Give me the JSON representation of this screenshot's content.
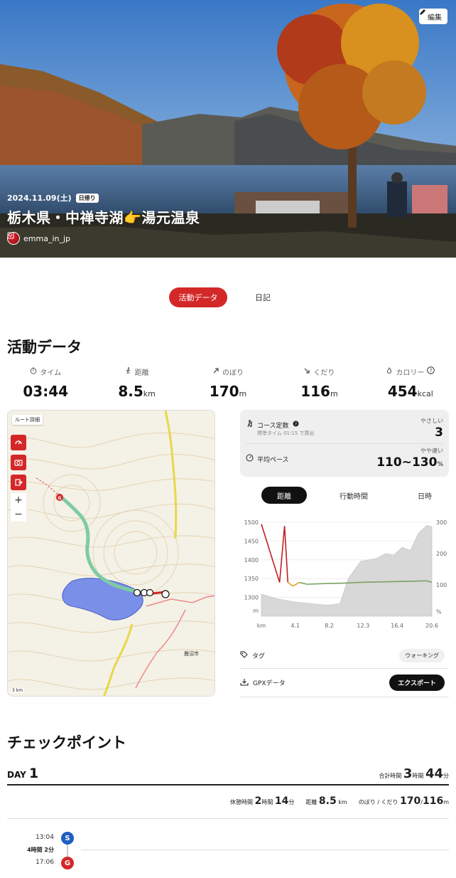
{
  "hero": {
    "edit_label": "編集",
    "date": "2024.11.09(土)",
    "badge": "日帰り",
    "title": "栃木県・中禅寺湖👉湯元温泉",
    "user": "emma_in_jp"
  },
  "tabs": {
    "activity": "活動データ",
    "diary": "日記"
  },
  "activity": {
    "title": "活動データ",
    "stats": [
      {
        "label": "タイム",
        "value": "03:44",
        "unit": ""
      },
      {
        "label": "距離",
        "value": "8.5",
        "unit": "km"
      },
      {
        "label": "のぼり",
        "value": "170",
        "unit": "m"
      },
      {
        "label": "くだり",
        "value": "116",
        "unit": "m"
      },
      {
        "label": "カロリー",
        "value": "454",
        "unit": "kcal"
      }
    ]
  },
  "map": {
    "route_detail": "ルート詳細",
    "zoom_in": "+",
    "zoom_out": "−",
    "scale": "3 km",
    "city_label": "鹿沼市"
  },
  "course": {
    "course_label": "コース定数",
    "course_sub": "標準タイム 01:15 で算出",
    "course_level": "やさしい",
    "course_value": "3",
    "pace_label": "平均ペース",
    "pace_level": "やや速い",
    "pace_value": "110~130",
    "pace_unit": "%"
  },
  "chart_tabs": {
    "distance": "距離",
    "time": "行動時間",
    "datetime": "日時"
  },
  "chart_data": {
    "type": "line",
    "x_unit": "km",
    "x_ticks": [
      "km",
      "4.1",
      "8.2",
      "12.3",
      "16.4",
      "20.6"
    ],
    "y_left_ticks": [
      "1500",
      "1450",
      "1400",
      "1350",
      "1300",
      "m"
    ],
    "y_right_ticks": [
      "300",
      "200",
      "100",
      "%"
    ],
    "ylim_left": [
      1250,
      1500
    ],
    "ylim_right": [
      0,
      300
    ],
    "elevation": {
      "x": [
        0.0,
        2.2,
        2.8,
        3.2,
        3.8,
        4.6,
        5.5,
        8.0,
        10.0,
        12.0,
        14.0,
        16.0,
        18.0,
        20.0,
        20.6
      ],
      "y": [
        1495,
        1340,
        1490,
        1340,
        1330,
        1340,
        1335,
        1337,
        1338,
        1340,
        1341,
        1342,
        1343,
        1344,
        1340
      ]
    },
    "pace_area": {
      "x": [
        0.0,
        2.0,
        4.0,
        6.0,
        8.0,
        9.5,
        10.5,
        12.0,
        14.0,
        15.0,
        16.0,
        17.0,
        18.0,
        19.0,
        20.0,
        20.6
      ],
      "y": [
        70,
        55,
        45,
        40,
        35,
        40,
        120,
        175,
        185,
        200,
        195,
        220,
        210,
        265,
        290,
        285
      ]
    }
  },
  "info": {
    "tag_label": "タグ",
    "tag_value": "ウォーキング",
    "gpx_label": "GPXデータ",
    "export_label": "エクスポート"
  },
  "checkpoint": {
    "title": "チェックポイント",
    "day_prefix": "DAY",
    "day_num": "1",
    "total_label": "合計時間",
    "total_h": "3",
    "total_h_unit": "時間",
    "total_m": "44",
    "total_m_unit": "分",
    "rest_label": "休憩時間",
    "rest_h": "2",
    "rest_h_unit": "時間",
    "rest_m": "14",
    "rest_m_unit": "分",
    "dist_label": "距離",
    "dist_value": "8.5",
    "dist_unit": "km",
    "updown_label": "のぼり / くだり",
    "up_value": "170",
    "down_value": "116",
    "updown_unit": "m",
    "start_time": "13:04",
    "start_marker": "S",
    "duration": "4時間 2分",
    "goal_time": "17:06",
    "goal_marker": "G"
  }
}
